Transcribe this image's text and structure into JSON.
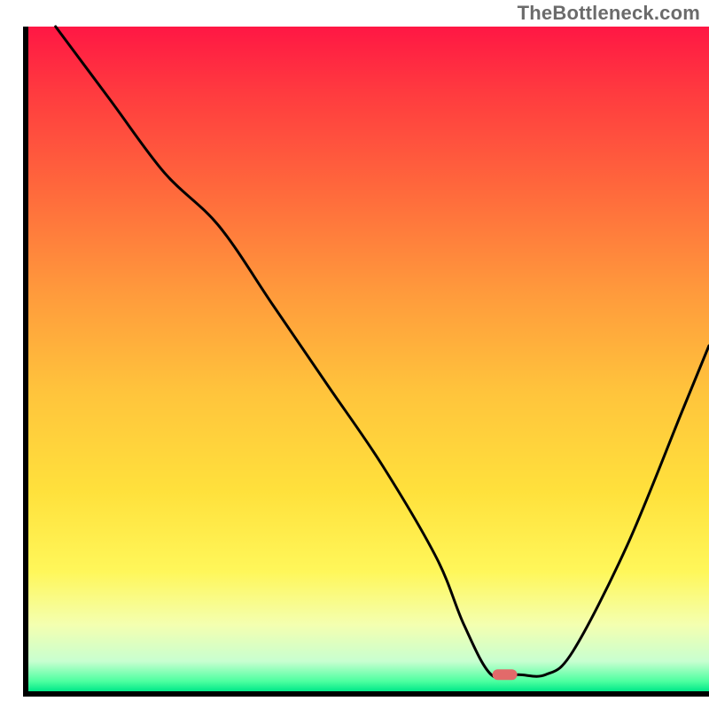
{
  "watermark": "TheBottleneck.com",
  "chart_data": {
    "type": "line",
    "title": "",
    "xlabel": "",
    "ylabel": "",
    "xlim": [
      0,
      100
    ],
    "ylim": [
      0,
      100
    ],
    "series": [
      {
        "name": "curve",
        "x": [
          4,
          12,
          20,
          28,
          36,
          44,
          52,
          60,
          64,
          68,
          72,
          76,
          80,
          88,
          96,
          100
        ],
        "y": [
          100,
          89,
          78,
          70,
          58,
          46,
          34,
          20,
          10,
          2.5,
          2.5,
          2.5,
          6,
          22,
          42,
          52
        ]
      }
    ],
    "marker": {
      "x": 70,
      "y": 2.5,
      "color": "#e26a6a"
    },
    "gradient_stops": [
      {
        "offset": 0.0,
        "color": "#ff1744"
      },
      {
        "offset": 0.1,
        "color": "#ff3b3f"
      },
      {
        "offset": 0.25,
        "color": "#ff6a3c"
      },
      {
        "offset": 0.4,
        "color": "#ff9a3c"
      },
      {
        "offset": 0.55,
        "color": "#ffc43c"
      },
      {
        "offset": 0.7,
        "color": "#ffe13c"
      },
      {
        "offset": 0.82,
        "color": "#fff75a"
      },
      {
        "offset": 0.9,
        "color": "#f4ffb0"
      },
      {
        "offset": 0.955,
        "color": "#c8ffd0"
      },
      {
        "offset": 0.985,
        "color": "#4dffa0"
      },
      {
        "offset": 1.0,
        "color": "#00e888"
      }
    ],
    "axis_color": "#000000",
    "axis_thickness": 6
  }
}
